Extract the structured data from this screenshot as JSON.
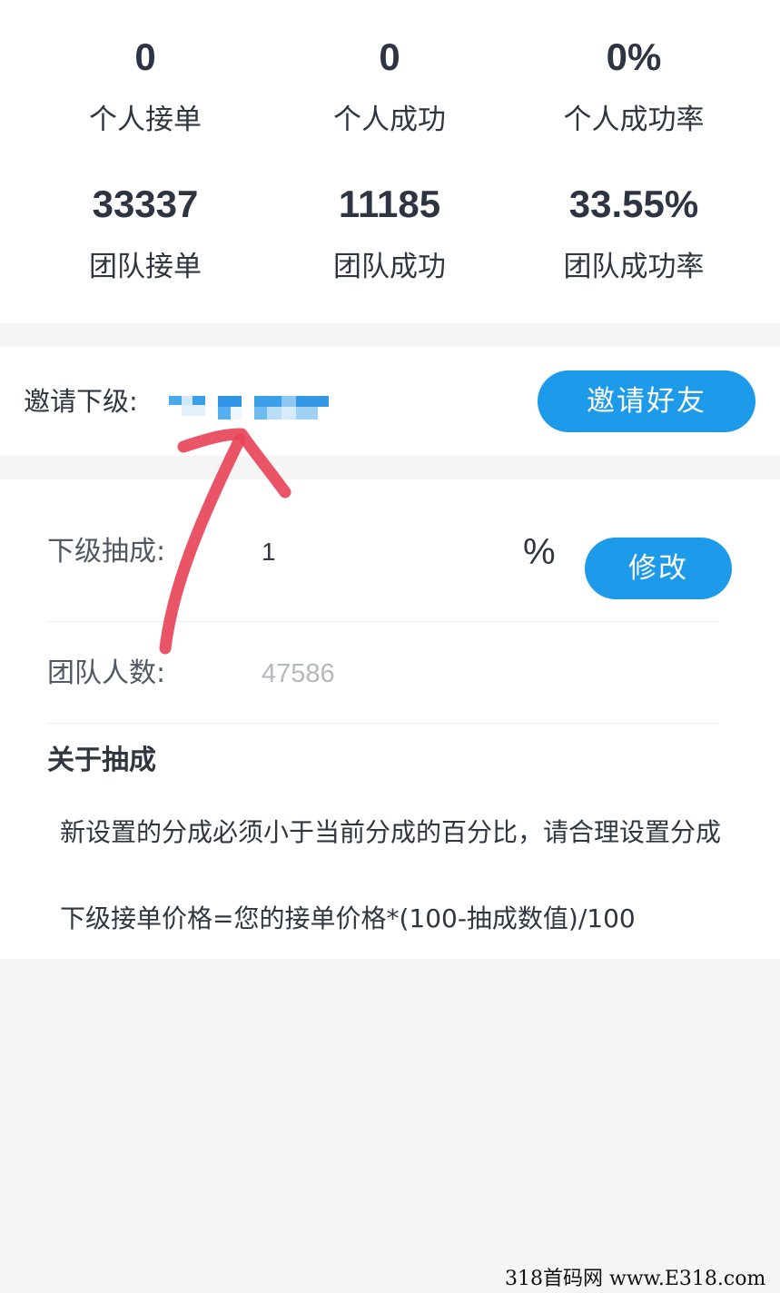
{
  "stats": {
    "personal_orders": {
      "value": "0",
      "label": "个人接单"
    },
    "personal_success": {
      "value": "0",
      "label": "个人成功"
    },
    "personal_rate": {
      "value": "0%",
      "label": "个人成功率"
    },
    "team_orders": {
      "value": "33337",
      "label": "团队接单"
    },
    "team_success": {
      "value": "11185",
      "label": "团队成功"
    },
    "team_rate": {
      "value": "33.55%",
      "label": "团队成功率"
    }
  },
  "invite": {
    "label": "邀请下级:",
    "button_label": "邀请好友"
  },
  "settings": {
    "commission_label": "下级抽成:",
    "commission_value": "1",
    "percent_sign": "%",
    "modify_button_label": "修改",
    "team_size_label": "团队人数:",
    "team_size_value": "47586"
  },
  "about": {
    "title": "关于抽成",
    "note": "新设置的分成必须小于当前分成的百分比，请合理设置分成",
    "formula": "下级接单价格=您的接单价格*(100-抽成数值)/100"
  },
  "watermark": {
    "text": "318首码网  www.E318.com"
  },
  "colors": {
    "accent": "#1e9aea",
    "annotation_arrow": "#e8455a",
    "page_background": "#f5f5f6"
  }
}
